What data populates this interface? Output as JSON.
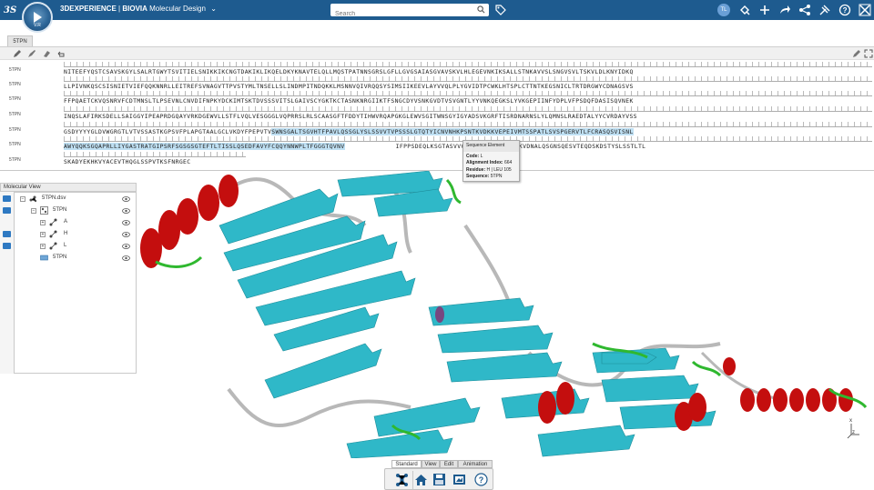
{
  "app": {
    "brand": "3DEXPERIENCE",
    "product": "BIOVIA",
    "module": "Molecular Design",
    "compass_version": "V.R"
  },
  "search": {
    "placeholder": "Search",
    "value": ""
  },
  "topbar_icons": [
    "logo-icon",
    "compass-icon",
    "tag-icon",
    "user-avatar",
    "share-icon",
    "add-icon",
    "forward-icon",
    "network-icon",
    "tools-icon",
    "help-icon",
    "close-icon"
  ],
  "avatar_initials": "TL",
  "sequence_panel": {
    "tab_label": "5TPN",
    "rows": [
      {
        "label": "5TPN",
        "residues": "NITEEFYQSTCSAVSKGYLSALRTGWYTSVITIELSNIKKIKCNGTDAKIKLIKQELDKYKNAVTELQLLMQSTPATNNSGRSLGFLLGVGSAIASGVAVSKVLHLEGEVNKIKSALLSTNKAVVSLSNGVSVLTSKVLDLKNYIDKQ"
      },
      {
        "label": "5TPN",
        "residues": "LLPIVNKQSCSISNIETVIEFQQKNNRLLEITREFSVNAGVTTPVSTYMLTNSELLSLINDMPITNDQKKLMSNNVQIVRQQSYSIMSIIKEEVLAYVVQLPLYGVIDTPCWKLHTSPLCTTNTKEGSNICLTRTDRGWYCDNAGSVS"
      },
      {
        "label": "5TPN",
        "residues": "FFPQAETCKVQSNRVFCDTMNSLTLPSEVNLCNVDIFNPKYDCKIMTSKTDVSSSVITSLGAIVSCYGKTKCTASNKNRGIIKTFSNGCDYVSNKGVDTVSVGNTLYYVNKQEGKSLYVKGEPIINFYDPLVFPSDQFDASISQVNEK"
      },
      {
        "label": "5TPN",
        "residues": "INQSLAFIRKSDELLSAIGGYIPEAPRDGQAYVRKDGEWVLLSTFLVQLVESGGGLVQPRRSLRLSCAASGFTFDDYTIHWVRQAPGKGLEWVSGITWNSGYIGYADSVKGRFTISRDNARNSLYLQMNSLRAEDTALYYCVRDAYVSS"
      },
      {
        "label": "5TPN",
        "residues_pre": "GSDYYYYGLDVWGRGTLVTVSSASTKGPSVFPLAPGTAALGCLVKDYFPEPVTV",
        "residues_hl": "SWNSGALTSGVHTFPAVLQSSGLYSLSSVVTVPSSSLGTQTYICNVNHKPSNTKVDKKVEPEIVMTSSPATLSVSPGERVTLFCRASQSVISNL"
      },
      {
        "label": "5TPN",
        "residues_hl": "AWYQQKSGQAPRLLIYGASTRATGIPSRFSGSGSGTEFTLTISSLQSEDFAVYFCQQYNNWPLTFGGGTQVNV",
        "residues_post": "IFPPSDEQLKSGTASVVCLLNNFYPREAKVQWKVDNALQSGNSQESVTEQDSKDSTYSLSSTLTL"
      },
      {
        "label": "5TPN",
        "residues": "SKADYEKHKVYACEVTHQGLSSPVTKSFNRGEC"
      }
    ]
  },
  "tooltip": {
    "title": "Sequence Element",
    "code_label": "Code:",
    "code_value": "L",
    "index_label": "Alignment Index:",
    "index_value": "664",
    "residue_label": "Residue:",
    "residue_value": "H | LEU 105",
    "sequence_label": "Sequence:",
    "sequence_value": "5TPN"
  },
  "molecular_view": {
    "title": "Molecular View",
    "tree": [
      {
        "label": "5TPN.dsv",
        "level": 0
      },
      {
        "label": "5TPN",
        "level": 1
      },
      {
        "label": "A",
        "level": 2
      },
      {
        "label": "H",
        "level": 2
      },
      {
        "label": "L",
        "level": 2
      },
      {
        "label": "5TPN",
        "level": 1
      }
    ]
  },
  "axes": {
    "x": "x",
    "z": "z"
  },
  "bottom_toolbar": {
    "tabs": [
      "Standard",
      "View",
      "Edit",
      "Animation"
    ],
    "active_tab": "Standard",
    "icons": [
      "molecule-tool-icon",
      "home-icon",
      "save-icon",
      "image-capture-icon",
      "help-icon"
    ]
  }
}
